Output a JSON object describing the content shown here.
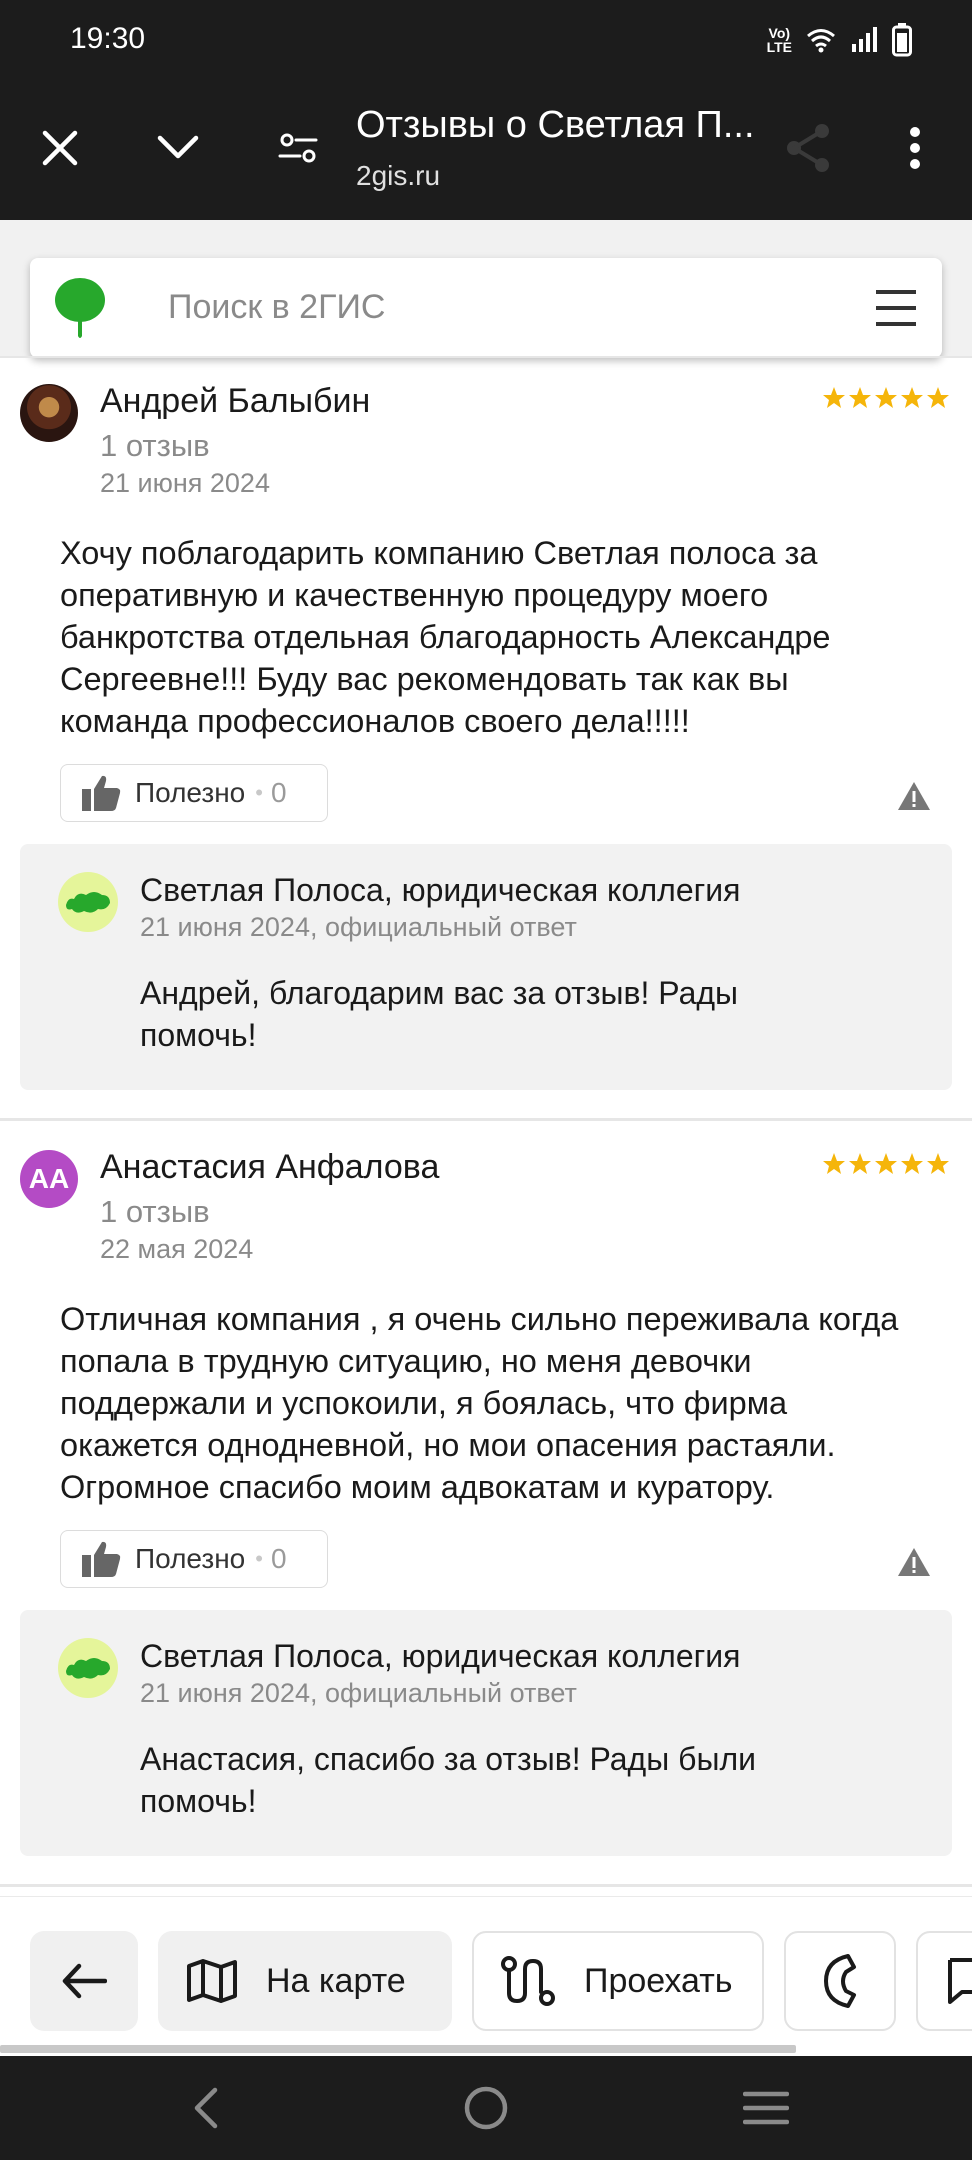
{
  "status_bar": {
    "time": "19:30",
    "volte_label": "Vo))\nLTE"
  },
  "toolbar": {
    "title": "Отзывы о Светлая П...",
    "url": "2gis.ru"
  },
  "search": {
    "placeholder": "Поиск в 2ГИС"
  },
  "reviews": [
    {
      "author": "Андрей Балыбин",
      "reviews_count": "1 отзыв",
      "date": "21 июня 2024",
      "rating": 5,
      "text": "Хочу поблагодарить компанию Светлая полоса за оперативную и качественную процедуру моего банкротства отдельная благодарность Александре Сергеевне!!! Буду вас рекомендовать так как вы команда профессионалов своего дела!!!!!",
      "useful_label": "Полезно",
      "useful_sep": "•",
      "useful_count": "0",
      "reply": {
        "org": "Светлая Полоса, юридическая коллегия",
        "meta": "21 июня 2024, официальный ответ",
        "text": "Андрей, благодарим вас за отзыв! Рады помочь!"
      }
    },
    {
      "author": "Анастасия Анфалова",
      "initials": "АА",
      "reviews_count": "1 отзыв",
      "date": "22 мая 2024",
      "rating": 5,
      "text": "Отличная компания , я очень сильно переживала когда попала в трудную ситуацию, но меня девочки поддержали и успокоили, я боялась, что фирма окажется однодневной, но мои опасения растаяли. Огромное спасибо моим адвокатам и куратору.",
      "useful_label": "Полезно",
      "useful_sep": "•",
      "useful_count": "0",
      "reply": {
        "org": "Светлая Полоса, юридическая коллегия",
        "meta": "21 июня 2024, официальный ответ",
        "text": "Анастасия, спасибо за отзыв! Рады были помочь!"
      }
    }
  ],
  "bottom_bar": {
    "map_label": "На карте",
    "route_label": "Проехать"
  },
  "colors": {
    "star": "#f5b50a",
    "dark_bar": "#1c1c1c",
    "brand_green": "#27a82c",
    "avatar_purple": "#b44bc5"
  },
  "icons": [
    "close-icon",
    "chevron-down-icon",
    "tune-icon",
    "share-icon",
    "more-vert-icon",
    "search-logo-icon",
    "menu-icon",
    "thumb-up-icon",
    "warning-icon",
    "back-arrow-icon",
    "map-icon",
    "route-icon",
    "phone-icon",
    "message-icon"
  ]
}
